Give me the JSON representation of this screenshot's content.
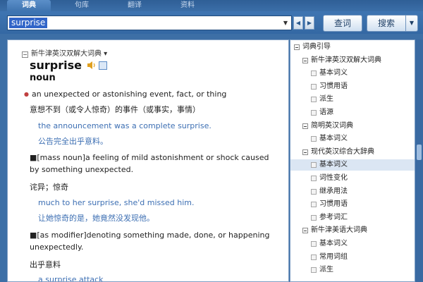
{
  "tabs": [
    {
      "label": "词典",
      "active": true
    },
    {
      "label": "句库",
      "active": false
    },
    {
      "label": "翻译",
      "active": false
    },
    {
      "label": "资料",
      "active": false
    }
  ],
  "search": {
    "value": "surprise",
    "query_button": "查词",
    "search_button": "搜索"
  },
  "entry": {
    "dictionary": "新牛津英汉双解大词典",
    "headword": "surprise",
    "pos": "noun",
    "senses": [
      {
        "def": "an unexpected or astonishing event, fact, or thing",
        "cn": "意想不到（或令人惊奇）的事件（或事实，事情）",
        "ex": "the announcement was a complete surprise.",
        "excn": "公告完全出乎意料。"
      },
      {
        "def": "■[mass noun]a feeling of mild astonishment or shock caused by something unexpected.",
        "cn": "诧异；惊奇",
        "ex": "much to her surprise, she'd missed him.",
        "excn": "让她惊奇的是，她竟然没发现他。"
      },
      {
        "def": "■[as modifier]denoting something made, done, or happening unexpectedly.",
        "cn": "出乎意料",
        "ex": "a surprise attack",
        "excn": ""
      }
    ]
  },
  "tree": {
    "root": "词典引导",
    "groups": [
      {
        "title": "新牛津英汉双解大词典",
        "items": [
          "基本词义",
          "习惯用语",
          "派生",
          "语源"
        ]
      },
      {
        "title": "简明英汉词典",
        "items": [
          "基本词义"
        ]
      },
      {
        "title": "现代英汉综合大辞典",
        "items": [
          "基本词义",
          "词性变化",
          "继承用法",
          "习惯用语",
          "参考词汇"
        ]
      },
      {
        "title": "新牛津美语大词典",
        "items": [
          "基本词义",
          "常用词组",
          "派生"
        ]
      }
    ]
  }
}
